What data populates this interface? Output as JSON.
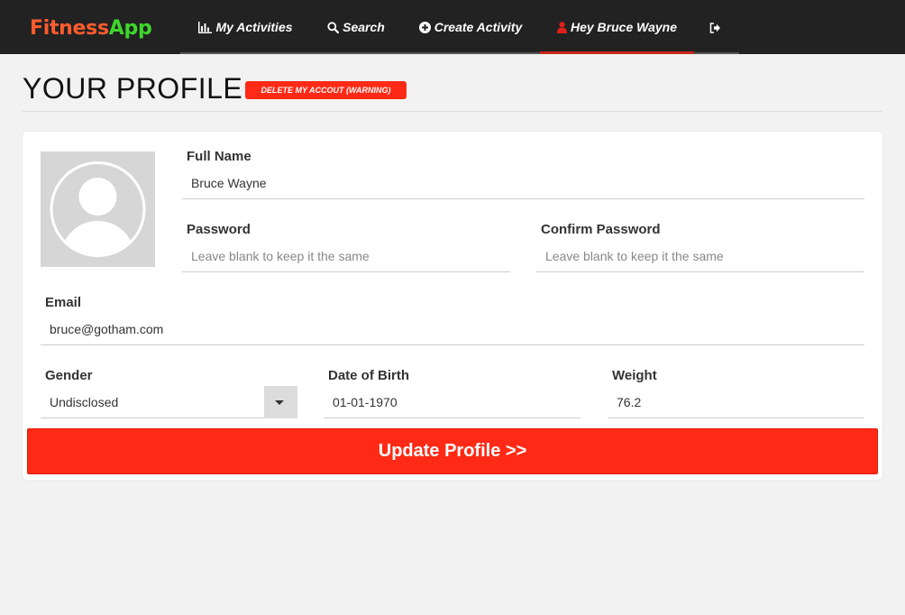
{
  "brand": {
    "part1": "Fitness",
    "part2": "App"
  },
  "nav": {
    "activities": {
      "label": "My Activities",
      "icon": "bar-chart-icon"
    },
    "search": {
      "label": "Search",
      "icon": "search-icon"
    },
    "create": {
      "label": "Create Activity",
      "icon": "plus-circle-icon"
    },
    "user": {
      "label": "Hey Bruce Wayne",
      "icon": "user-icon"
    },
    "logout": {
      "icon": "sign-out-icon"
    }
  },
  "header": {
    "title": "YOUR PROFILE",
    "delete_label": "DELETE MY ACCOUT (WARNING)"
  },
  "form": {
    "full_name": {
      "label": "Full Name",
      "value": "Bruce Wayne"
    },
    "password": {
      "label": "Password",
      "placeholder": "Leave blank to keep it the same"
    },
    "confirm_password": {
      "label": "Confirm Password",
      "placeholder": "Leave blank to keep it the same"
    },
    "email": {
      "label": "Email",
      "value": "bruce@gotham.com"
    },
    "gender": {
      "label": "Gender",
      "value": "Undisclosed"
    },
    "dob": {
      "label": "Date of Birth",
      "value": "01-01-1970"
    },
    "weight": {
      "label": "Weight",
      "value": "76.2"
    },
    "submit_label": "Update Profile >>"
  },
  "colors": {
    "navbar": "#222222",
    "accent_red": "#ff2a16",
    "brand_orange": "#ff5b2e",
    "brand_green": "#3ed72b"
  }
}
